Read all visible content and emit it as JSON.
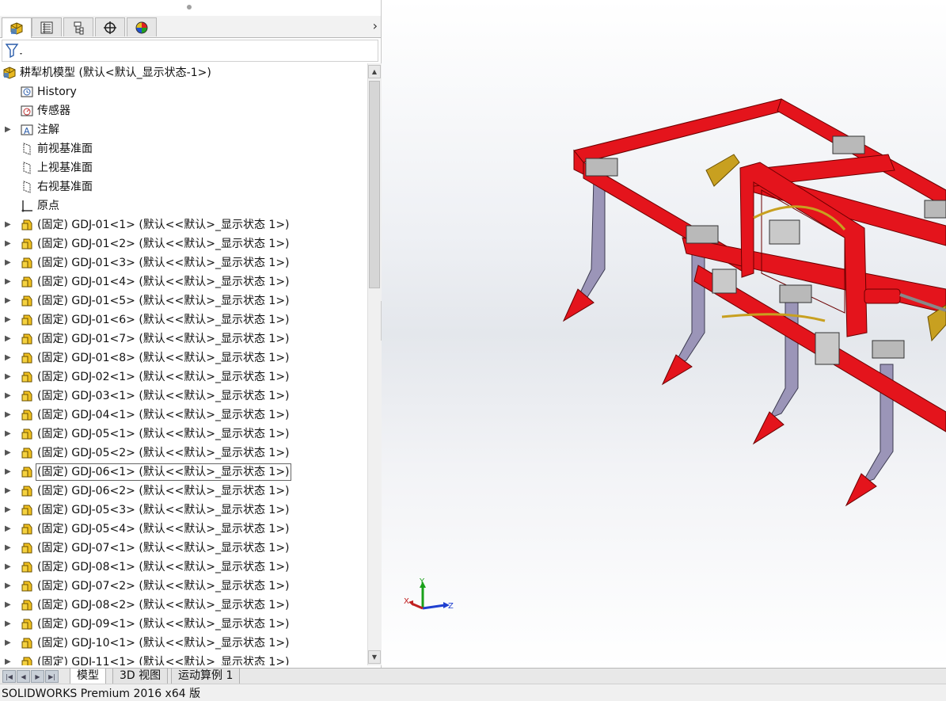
{
  "tree": {
    "root": "耕犁机模型  (默认<默认_显示状态-1>)",
    "items": [
      {
        "label": "History",
        "icon": "history-icon",
        "arrow": false
      },
      {
        "label": "传感器",
        "icon": "sensor-icon",
        "arrow": false
      },
      {
        "label": "注解",
        "icon": "annotation-icon",
        "arrow": true
      },
      {
        "label": "前视基准面",
        "icon": "plane-icon",
        "arrow": false
      },
      {
        "label": "上视基准面",
        "icon": "plane-icon",
        "arrow": false
      },
      {
        "label": "右视基准面",
        "icon": "plane-icon",
        "arrow": false
      },
      {
        "label": "原点",
        "icon": "origin-icon",
        "arrow": false
      }
    ],
    "components": [
      "(固定) GDJ-01<1> (默认<<默认>_显示状态 1>)",
      "(固定) GDJ-01<2> (默认<<默认>_显示状态 1>)",
      "(固定) GDJ-01<3> (默认<<默认>_显示状态 1>)",
      "(固定) GDJ-01<4> (默认<<默认>_显示状态 1>)",
      "(固定) GDJ-01<5> (默认<<默认>_显示状态 1>)",
      "(固定) GDJ-01<6> (默认<<默认>_显示状态 1>)",
      "(固定) GDJ-01<7> (默认<<默认>_显示状态 1>)",
      "(固定) GDJ-01<8> (默认<<默认>_显示状态 1>)",
      "(固定) GDJ-02<1> (默认<<默认>_显示状态 1>)",
      "(固定) GDJ-03<1> (默认<<默认>_显示状态 1>)",
      "(固定) GDJ-04<1> (默认<<默认>_显示状态 1>)",
      "(固定) GDJ-05<1> (默认<<默认>_显示状态 1>)",
      "(固定) GDJ-05<2> (默认<<默认>_显示状态 1>)",
      "(固定) GDJ-06<1> (默认<<默认>_显示状态 1>)",
      "(固定) GDJ-06<2> (默认<<默认>_显示状态 1>)",
      "(固定) GDJ-05<3> (默认<<默认>_显示状态 1>)",
      "(固定) GDJ-05<4> (默认<<默认>_显示状态 1>)",
      "(固定) GDJ-07<1> (默认<<默认>_显示状态 1>)",
      "(固定) GDJ-08<1> (默认<<默认>_显示状态 1>)",
      "(固定) GDJ-07<2> (默认<<默认>_显示状态 1>)",
      "(固定) GDJ-08<2> (默认<<默认>_显示状态 1>)",
      "(固定) GDJ-09<1> (默认<<默认>_显示状态 1>)",
      "(固定) GDJ-10<1> (默认<<默认>_显示状态 1>)",
      "(固定) GDJ-11<1> (默认<<默认>_显示状态 1>)"
    ],
    "selected_index": 13
  },
  "panel_tabs": [
    {
      "icon": "feature-manager-icon"
    },
    {
      "icon": "property-manager-icon"
    },
    {
      "icon": "configuration-manager-icon"
    },
    {
      "icon": "dimxpert-icon"
    },
    {
      "icon": "display-manager-icon"
    }
  ],
  "triad": {
    "x": "X",
    "y": "Y",
    "z": "Z"
  },
  "bottom_tabs": [
    "模型",
    "3D 视图",
    "运动算例 1"
  ],
  "status": "SOLIDWORKS Premium 2016 x64 版",
  "colors": {
    "frame_red": "#e4141c",
    "shank_lilac": "#9b95b8",
    "bracket_gray": "#c9c9c9",
    "hydraulic_yellow": "#c8a020"
  }
}
